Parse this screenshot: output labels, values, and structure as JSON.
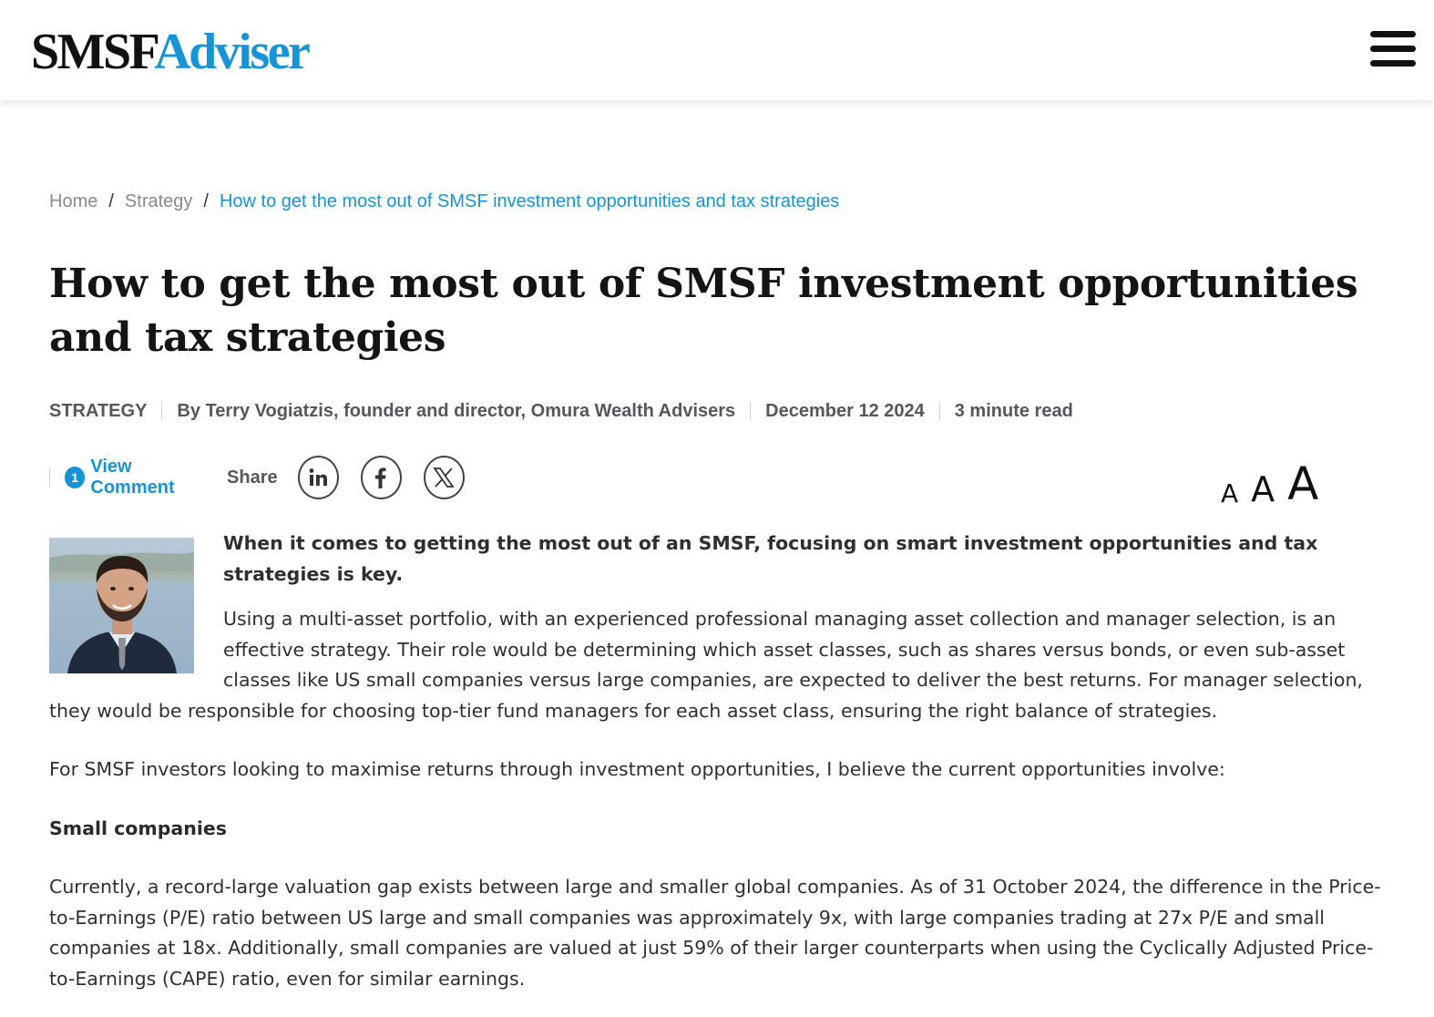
{
  "header": {
    "logo_part1": "SMSF",
    "logo_part2": "Adviser",
    "menu_icon": "hamburger-menu-icon",
    "brand_color": "#1793d6"
  },
  "breadcrumb": {
    "items": [
      "Home",
      "Strategy"
    ],
    "separator": "/",
    "current": "How to get the most out of SMSF investment opportunities and tax strategies"
  },
  "article": {
    "title": "How to get the most out of SMSF investment opportunities and tax strategies",
    "category": "STRATEGY",
    "byline": "By Terry Vogiatzis, founder and director, Omura Wealth Advisers",
    "date": "December 12 2024",
    "read_time": "3 minute read",
    "comment_count": "1",
    "view_comment_label": "View Comment",
    "share_label": "Share",
    "social_icons": [
      "linkedin-icon",
      "facebook-icon",
      "x-icon"
    ],
    "font_size_labels": [
      "A",
      "A",
      "A"
    ],
    "lead": "When it comes to getting the most out of an SMSF, focusing on smart investment opportunities and tax strategies is key.",
    "paragraph_1": "Using a multi-asset portfolio, with an experienced professional managing asset collection and manager selection, is an effective strategy. Their role would be determining which asset classes, such as shares versus bonds, or even sub-asset classes like US small companies versus large companies, are expected to deliver the best returns. For manager selection, they would be responsible for choosing top-tier fund managers for each asset class, ensuring the right balance of strategies.",
    "paragraph_2": "For SMSF investors looking to maximise returns through investment opportunities, I believe the current opportunities involve:",
    "subheading": "Small companies",
    "paragraph_3": "Currently, a record-large valuation gap exists between large and smaller global companies. As of 31 October 2024, the difference in the Price-to-Earnings (P/E) ratio between US large and small companies was approximately 9x, with large companies trading at 27x P/E and small companies at 18x. Additionally, small companies are valued at just 59% of their larger counterparts when using the Cyclically Adjusted Price-to-Earnings (CAPE) ratio, even for similar earnings."
  }
}
